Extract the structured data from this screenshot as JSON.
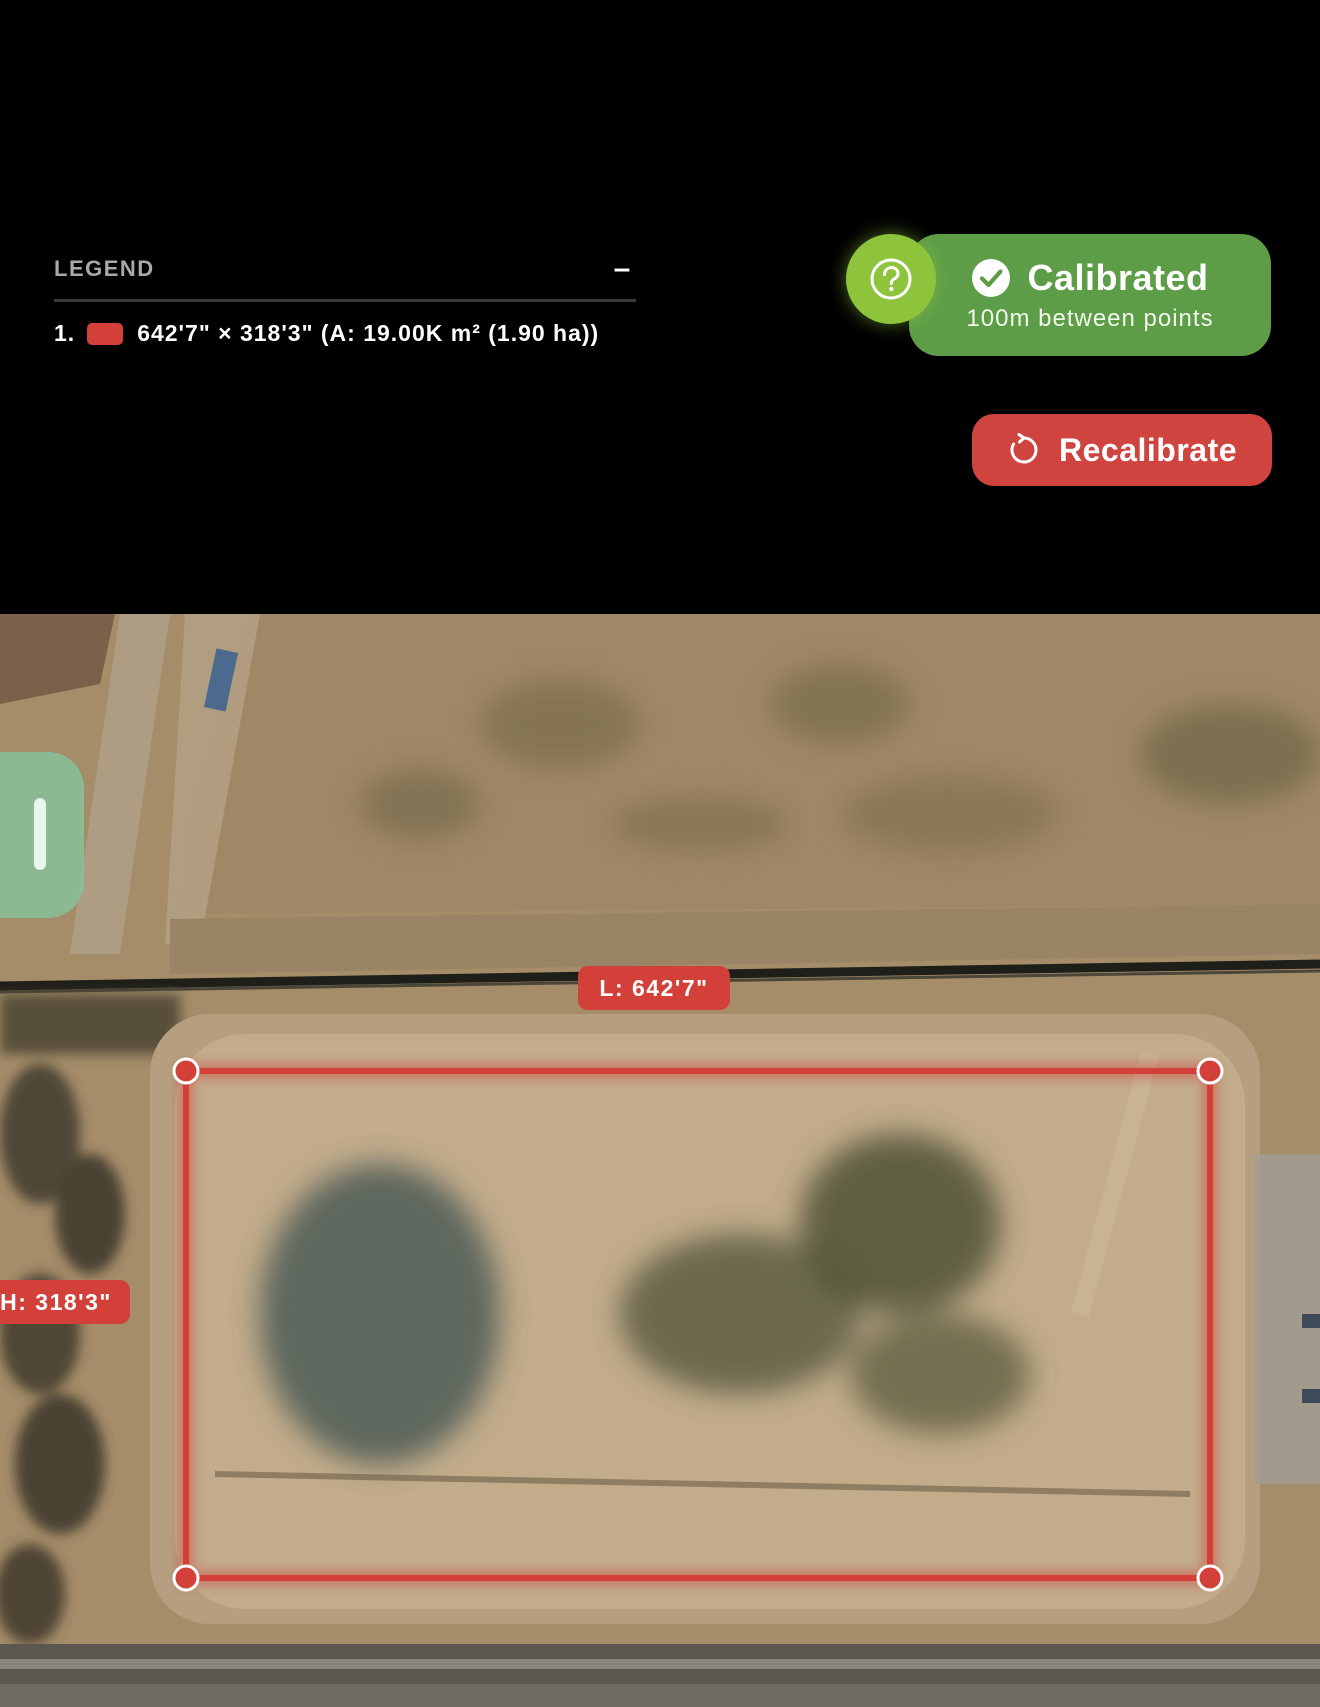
{
  "legend": {
    "title": "LEGEND",
    "collapse_symbol": "–",
    "items": [
      {
        "index": "1.",
        "color": "#d3403a",
        "text": "642'7\" × 318'3\" (A: 19.00K m² (1.90 ha))"
      }
    ]
  },
  "calibration": {
    "status": "Calibrated",
    "detail": "100m between points",
    "help_icon": "question-circle-icon",
    "status_icon": "check-circle-icon",
    "color": "#5e9d48",
    "help_color": "#8dc43c"
  },
  "recalibrate": {
    "label": "Recalibrate",
    "icon": "refresh-icon",
    "color": "#d0443f"
  },
  "measurement": {
    "color": "#d3403a",
    "length_label": "L: 642'7\"",
    "height_label": "H: 318'3\""
  }
}
